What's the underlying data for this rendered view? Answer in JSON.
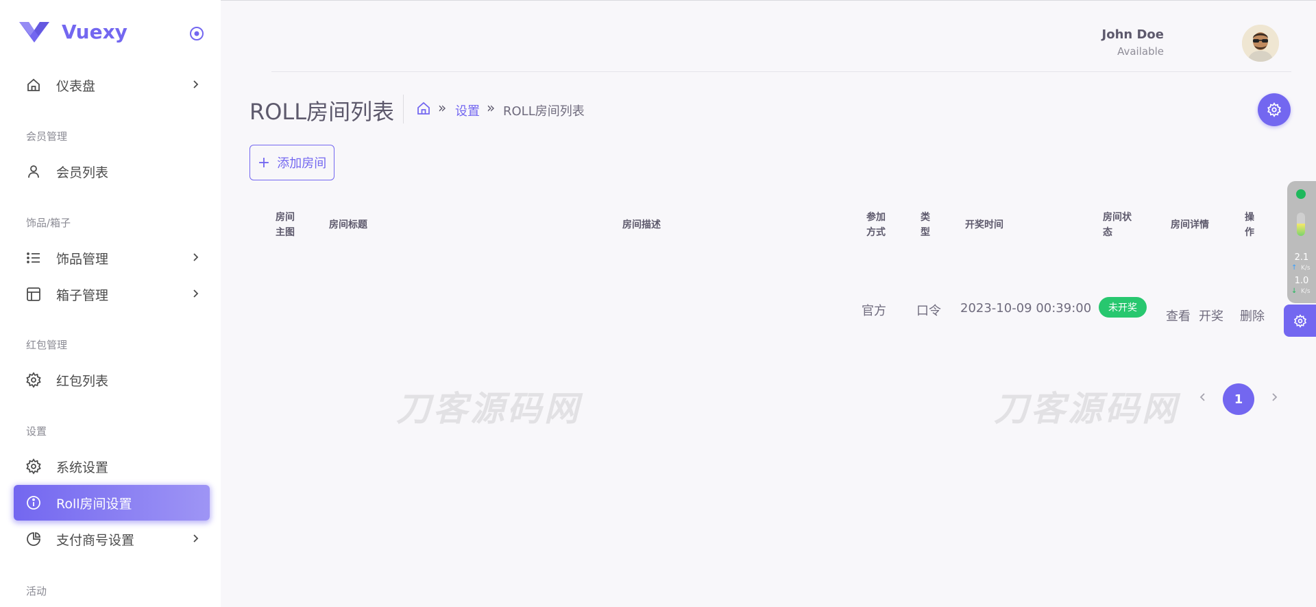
{
  "brand": {
    "name": "Vuexy"
  },
  "user": {
    "name": "John Doe",
    "status": "Available"
  },
  "sidebar": {
    "items": [
      {
        "label": "仪表盘"
      },
      {
        "section": "会员管理"
      },
      {
        "label": "会员列表"
      },
      {
        "section": "饰品/箱子"
      },
      {
        "label": "饰品管理"
      },
      {
        "label": "箱子管理"
      },
      {
        "section": "红包管理"
      },
      {
        "label": "红包列表"
      },
      {
        "section": "设置"
      },
      {
        "label": "系统设置"
      },
      {
        "label": "Roll房间设置"
      },
      {
        "label": "支付商号设置"
      },
      {
        "section": "活动"
      }
    ]
  },
  "page": {
    "title": "ROLL房间列表",
    "breadcrumb": {
      "sep": "»",
      "link": "设置",
      "current": "ROLL房间列表"
    },
    "add_button": "添加房间"
  },
  "table": {
    "headers": [
      [
        "房间",
        "主图"
      ],
      [
        "房间标题"
      ],
      [
        "房间描述"
      ],
      [
        "参加",
        "方式"
      ],
      [
        "类",
        "型"
      ],
      [
        "开奖时间"
      ],
      [
        "房间状",
        "态"
      ],
      [
        "房间详情"
      ],
      [
        "操",
        "作"
      ]
    ],
    "row": {
      "join": "官方",
      "type": "口令",
      "draw_time": "2023-10-09 00:39:00",
      "status": "未开奖",
      "view": "查看",
      "draw": "开奖",
      "delete": "删除"
    }
  },
  "pagination": {
    "current": "1"
  },
  "watermark": "刀客源码网",
  "widget": {
    "up": "2.1",
    "down": "1.0",
    "unit": "K/s"
  },
  "colors": {
    "primary": "#7367f0",
    "success": "#28c76f",
    "background": "#f8f7fa"
  }
}
